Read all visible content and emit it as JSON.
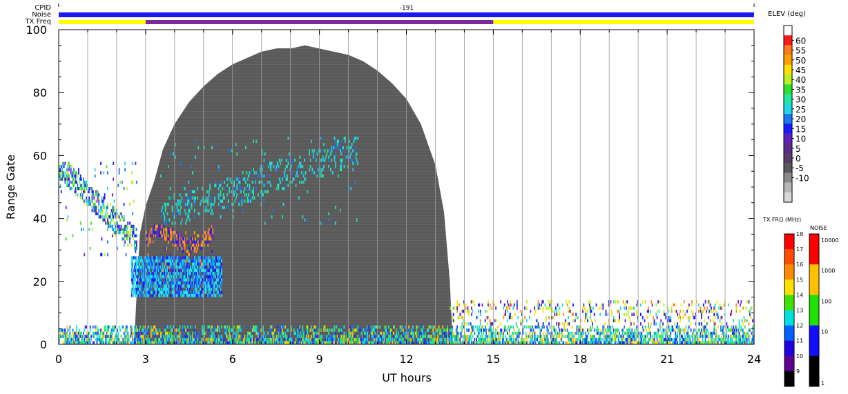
{
  "header": {
    "cpid_label": "CPID",
    "noise_label": "Noise",
    "txfreq_label": "TX Freq",
    "cpid_value": "-191"
  },
  "chart_data": {
    "type": "heatmap",
    "xlabel": "UT hours",
    "ylabel": "Range Gate",
    "xlim": [
      0,
      24
    ],
    "ylim": [
      0,
      100
    ],
    "x_ticks": [
      0,
      3,
      6,
      9,
      12,
      15,
      18,
      21,
      24
    ],
    "y_ticks": [
      0,
      20,
      40,
      60,
      80,
      100
    ],
    "minor_x_step_hours": 1,
    "grid": "vertical lines every 1 hour",
    "ground_scatter_color": "#5a5a5a",
    "ground_scatter_envelope": [
      [
        2.6,
        0
      ],
      [
        2.8,
        35
      ],
      [
        3.0,
        44
      ],
      [
        3.3,
        52
      ],
      [
        3.6,
        62
      ],
      [
        4.0,
        70
      ],
      [
        4.5,
        77
      ],
      [
        5.0,
        82
      ],
      [
        5.5,
        86
      ],
      [
        6.0,
        89
      ],
      [
        6.5,
        91
      ],
      [
        7.0,
        93
      ],
      [
        7.5,
        94
      ],
      [
        8.0,
        94
      ],
      [
        8.5,
        95
      ],
      [
        9.0,
        94
      ],
      [
        9.5,
        93
      ],
      [
        10.0,
        92
      ],
      [
        10.5,
        90
      ],
      [
        11.0,
        87
      ],
      [
        11.5,
        83
      ],
      [
        12.0,
        78
      ],
      [
        12.5,
        70
      ],
      [
        13.0,
        57
      ],
      [
        13.3,
        42
      ],
      [
        13.5,
        20
      ],
      [
        13.6,
        0
      ]
    ],
    "elev_colorbar": {
      "title": "ELEV (deg)",
      "labels": [
        "60",
        "55",
        "50",
        "45",
        "40",
        "35",
        "30",
        "25",
        "20",
        "15",
        "10",
        "5",
        "0",
        "-5",
        "-10"
      ],
      "colors": [
        "#ffffff",
        "#ff1a1a",
        "#ff7a1a",
        "#ffa000",
        "#ffe000",
        "#b8f020",
        "#30e030",
        "#20e8a0",
        "#20d8e8",
        "#1a78f0",
        "#1a1aff",
        "#6020c0",
        "#5a2a8a",
        "#5a3a6a",
        "#5a5a5a",
        "#8a8a8a",
        "#b8b8b8",
        "#d8d8d8"
      ]
    },
    "txfrq_colorbar": {
      "title": "TX FRQ (MHz)",
      "labels": [
        "18",
        "17",
        "16",
        "15",
        "14",
        "13",
        "12",
        "11",
        "10",
        "9"
      ],
      "colors": [
        "#ff0000",
        "#ff4a00",
        "#ff8a00",
        "#ffe000",
        "#40e000",
        "#00e0e0",
        "#0060ff",
        "#2000e0",
        "#600090",
        "#000000"
      ]
    },
    "noise_colorbar": {
      "title": "NOISE",
      "labels": [
        "10000",
        "1000",
        "100",
        "10",
        "1"
      ],
      "colors": [
        "#ff0000",
        "#ffc000",
        "#20e000",
        "#1010ff",
        "#000000"
      ]
    },
    "header_bars": {
      "noise_color": "#1a1aee",
      "txfreq_segments": [
        {
          "start": 0,
          "end": 3,
          "color": "#ffff00"
        },
        {
          "start": 3,
          "end": 15,
          "color": "#7a2a9a"
        },
        {
          "start": 15,
          "end": 24,
          "color": "#ffff00"
        }
      ]
    },
    "scatter_features": [
      {
        "name": "near-range band",
        "x0": 0,
        "x1": 24,
        "y0": 0,
        "y1": 6,
        "density": 0.6,
        "palette": [
          "#2030ff",
          "#20d8e8",
          "#40e040",
          "#ffd000",
          "#1a78f0",
          "#20e8a0"
        ]
      },
      {
        "name": "morning echoes",
        "x0": 0,
        "x1": 2.7,
        "y0": 28,
        "y1": 58,
        "density": 0.25,
        "palette": [
          "#1a1aff",
          "#20d8e8",
          "#30e030",
          "#6020c0",
          "#1a78f0",
          "#b8f020"
        ]
      },
      {
        "name": "cyan blob",
        "x0": 2.5,
        "x1": 5.6,
        "y0": 15,
        "y1": 28,
        "density": 0.75,
        "palette": [
          "#20d8e8",
          "#1a78f0",
          "#1a1aff",
          "#20e8e0"
        ]
      },
      {
        "name": "orange arc",
        "x0": 3.0,
        "x1": 5.3,
        "y0": 20,
        "y1": 38,
        "density": 0.5,
        "palette": [
          "#ff8a1a",
          "#6020c0",
          "#1a1aff",
          "#ffa000"
        ]
      },
      {
        "name": "inner dayside echoes",
        "x0": 3.5,
        "x1": 10.3,
        "y0": 38,
        "y1": 66,
        "density": 0.12,
        "palette": [
          "#20e0e8",
          "#20e8a0",
          "#1a78f0",
          "#30c8d0"
        ]
      },
      {
        "name": "afternoon sparse",
        "x0": 13.5,
        "x1": 24,
        "y0": 6,
        "y1": 14,
        "density": 0.18,
        "palette": [
          "#ff8a1a",
          "#ffe000",
          "#b8f020",
          "#20d8e8",
          "#1a1aff",
          "#6020c0"
        ]
      }
    ]
  }
}
